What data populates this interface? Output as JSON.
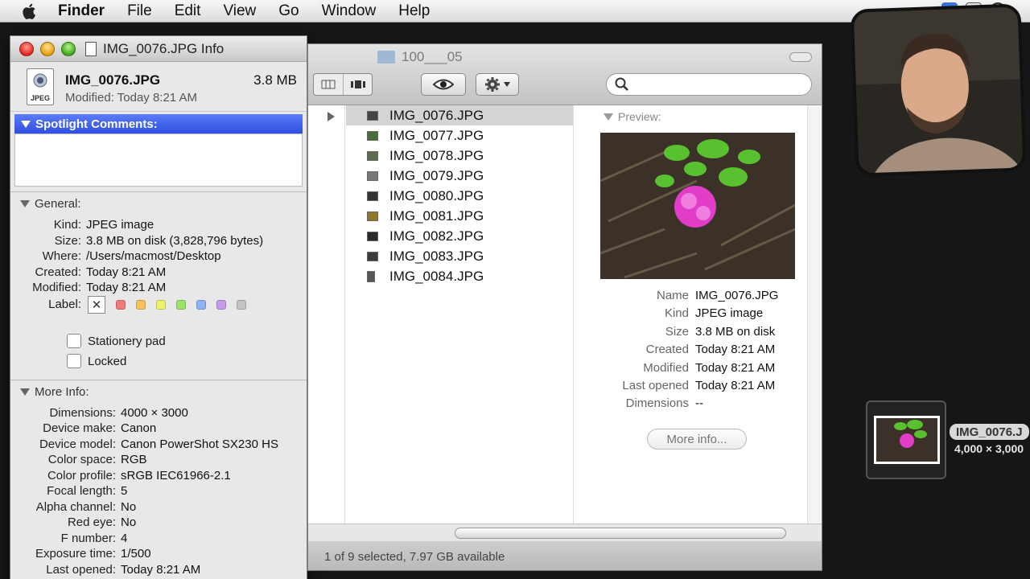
{
  "menubar": {
    "items": [
      "Finder",
      "File",
      "Edit",
      "View",
      "Go",
      "Window",
      "Help"
    ]
  },
  "info_window": {
    "title": "IMG_0076.JPG Info",
    "icon_badge": "JPEG",
    "file_name": "IMG_0076.JPG",
    "file_size": "3.8 MB",
    "modified_line": "Modified: Today 8:21 AM",
    "spotlight_header": "Spotlight Comments:",
    "general_header": "General:",
    "general": [
      {
        "k": "Kind:",
        "v": "JPEG image"
      },
      {
        "k": "Size:",
        "v": "3.8 MB on disk (3,828,796 bytes)"
      },
      {
        "k": "Where:",
        "v": "/Users/macmost/Desktop"
      },
      {
        "k": "Created:",
        "v": "Today 8:21 AM"
      },
      {
        "k": "Modified:",
        "v": "Today 8:21 AM"
      }
    ],
    "label_key": "Label:",
    "label_none": "✕",
    "label_colors": [
      "#f07a7a",
      "#f5c25c",
      "#eef16a",
      "#9be36a",
      "#8eb3f0",
      "#c89ae8",
      "#c4c4c4"
    ],
    "stationery": "Stationery pad",
    "locked": "Locked",
    "more_header": "More Info:",
    "more": [
      {
        "k": "Dimensions:",
        "v": "4000 × 3000"
      },
      {
        "k": "Device make:",
        "v": "Canon"
      },
      {
        "k": "Device model:",
        "v": "Canon PowerShot SX230 HS"
      },
      {
        "k": "Color space:",
        "v": "RGB"
      },
      {
        "k": "Color profile:",
        "v": "sRGB IEC61966-2.1"
      },
      {
        "k": "Focal length:",
        "v": "5"
      },
      {
        "k": "Alpha channel:",
        "v": "No"
      },
      {
        "k": "Red eye:",
        "v": "No"
      },
      {
        "k": "F number:",
        "v": "4"
      },
      {
        "k": "Exposure time:",
        "v": "1/500"
      },
      {
        "k": "Last opened:",
        "v": "Today 8:21 AM"
      }
    ]
  },
  "finder": {
    "title": "100___05",
    "files": [
      "IMG_0076.JPG",
      "IMG_0077.JPG",
      "IMG_0078.JPG",
      "IMG_0079.JPG",
      "IMG_0080.JPG",
      "IMG_0081.JPG",
      "IMG_0082.JPG",
      "IMG_0083.JPG",
      "IMG_0084.JPG"
    ],
    "preview_header": "Preview:",
    "preview_meta": [
      {
        "k": "Name",
        "v": "IMG_0076.JPG"
      },
      {
        "k": "Kind",
        "v": "JPEG image"
      },
      {
        "k": "Size",
        "v": "3.8 MB on disk"
      },
      {
        "k": "Created",
        "v": "Today 8:21 AM"
      },
      {
        "k": "Modified",
        "v": "Today 8:21 AM"
      },
      {
        "k": "Last opened",
        "v": "Today 8:21 AM"
      },
      {
        "k": "Dimensions",
        "v": "--"
      }
    ],
    "more_info_button": "More info...",
    "status": "1 of 9 selected, 7.97 GB available"
  },
  "desktop_icon": {
    "name": "IMG_0076.J",
    "dims": "4,000 × 3,000"
  }
}
